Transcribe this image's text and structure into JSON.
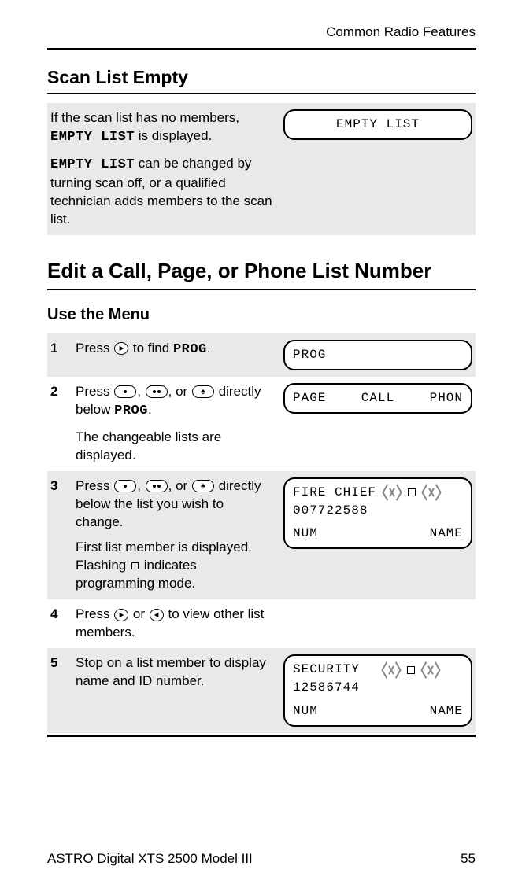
{
  "header": {
    "chapter": "Common Radio Features"
  },
  "sections": {
    "scanListEmpty": {
      "title": "Scan List Empty",
      "para1_a": "If the scan list has no members, ",
      "para1_code": "EMPTY LIST",
      "para1_b": " is displayed.",
      "para2_code": "EMPTY LIST",
      "para2_rest": " can be changed by turning scan off, or a qualified technician adds members to the scan list.",
      "display": "EMPTY LIST"
    },
    "editList": {
      "title": "Edit a Call, Page, or Phone List Number",
      "subtitle": "Use the Menu",
      "steps": [
        {
          "num": "1",
          "text_a": "Press ",
          "text_b": " to find ",
          "code": "PROG",
          "text_c": ".",
          "display": {
            "line1": "PROG"
          }
        },
        {
          "num": "2",
          "text_a": "Press ",
          "text_b": ", ",
          "text_c": ", or ",
          "text_d": " directly below ",
          "code": "PROG",
          "text_e": ".",
          "para2": "The changeable lists are displayed.",
          "display": {
            "l": "PAGE",
            "c": "CALL",
            "r": "PHON"
          }
        },
        {
          "num": "3",
          "text_a": "Press ",
          "text_b": ", ",
          "text_c": ", or ",
          "text_d": " directly below the list you wish to change.",
          "para2_a": "First list member is displayed. Flashing ",
          "para2_b": " indicates programming mode.",
          "display": {
            "name": "FIRE CHIEF",
            "id": "007722588",
            "bl": "NUM",
            "br": "NAME"
          }
        },
        {
          "num": "4",
          "text_a": "Press ",
          "text_b": " or ",
          "text_c": " to view other list members."
        },
        {
          "num": "5",
          "text": "Stop on a list member to display name and ID number.",
          "display": {
            "name": "SECURITY",
            "id": "12586744",
            "bl": "NUM",
            "br": "NAME"
          }
        }
      ]
    }
  },
  "footer": {
    "model": "ASTRO Digital XTS 2500 Model III",
    "page": "55"
  }
}
